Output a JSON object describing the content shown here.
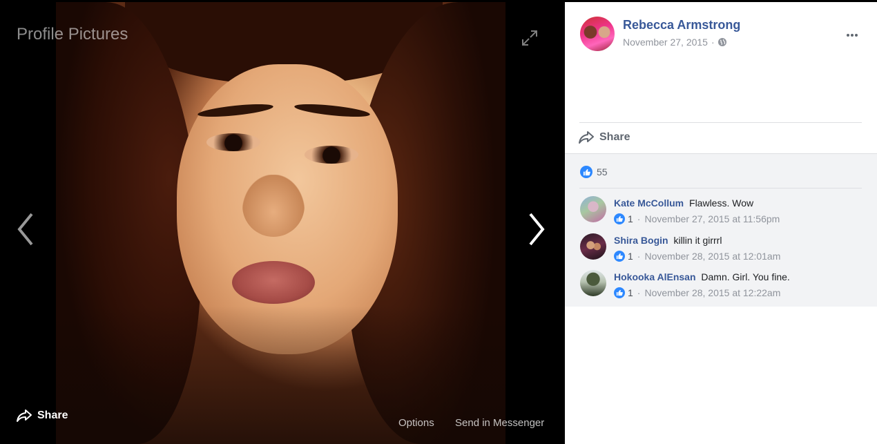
{
  "viewer": {
    "album_title": "Profile Pictures",
    "share_label": "Share",
    "options_label": "Options",
    "messenger_label": "Send in Messenger"
  },
  "post": {
    "poster_name": "Rebecca Armstrong",
    "date": "November 27, 2015",
    "separator": "·",
    "share_label": "Share",
    "like_count": "55"
  },
  "comments": [
    {
      "name": "Kate McCollum",
      "text": "Flawless. Wow",
      "likes": "1",
      "separator": "·",
      "time": "November 27, 2015 at 11:56pm"
    },
    {
      "name": "Shira Bogin",
      "text": "killin it girrrl",
      "likes": "1",
      "separator": "·",
      "time": "November 28, 2015 at 12:01am"
    },
    {
      "name": "Hokooka AlEnsan",
      "text": "Damn. Girl. You fine.",
      "likes": "1",
      "separator": "·",
      "time": "November 28, 2015 at 12:22am"
    }
  ],
  "colors": {
    "link_blue": "#385898",
    "like_blue": "#2d88ff",
    "meta_gray": "#90949c",
    "comments_bg": "#f2f3f5"
  },
  "icons": [
    "expand-icon",
    "chevron-left-icon",
    "chevron-right-icon",
    "share-arrow-icon",
    "globe-icon",
    "more-dots-icon",
    "thumbs-up-icon"
  ]
}
